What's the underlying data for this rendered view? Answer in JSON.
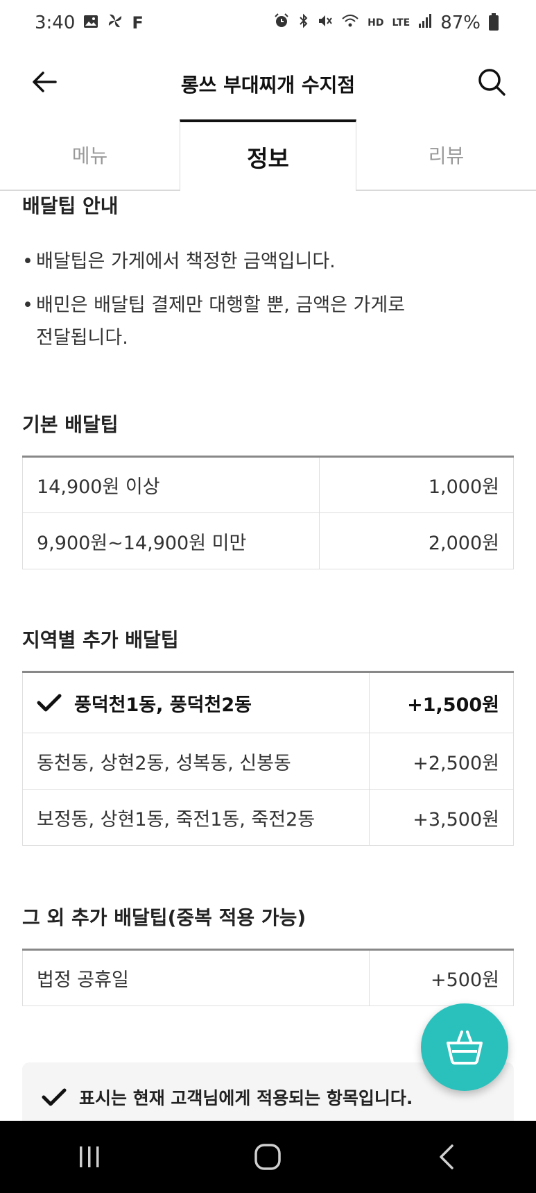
{
  "status_bar": {
    "time": "3:40",
    "left_icons": [
      "image-icon",
      "pinwheel-icon",
      "facebook-icon"
    ],
    "right_icons": [
      "alarm-icon",
      "bluetooth-icon",
      "mute-icon",
      "wifi-icon",
      "hd-voice-icon",
      "lte-icon",
      "signal-icon"
    ],
    "hd_label": "HD",
    "lte_label": "LTE",
    "battery_percent": "87%"
  },
  "header": {
    "title": "롱쓰 부대찌개 수지점"
  },
  "tabs": [
    {
      "label": "메뉴",
      "active": false
    },
    {
      "label": "정보",
      "active": true
    },
    {
      "label": "리뷰",
      "active": false
    }
  ],
  "delivery_info": {
    "title": "배달팁 안내",
    "bullets": [
      "배달팁은 가게에서 책정한 금액입니다.",
      "배민은 배달팁 결제만 대행할 뿐, 금액은 가게로 전달됩니다."
    ]
  },
  "basic_fee": {
    "title": "기본 배달팁",
    "rows": [
      {
        "condition": "14,900원 이상",
        "amount": "1,000원"
      },
      {
        "condition": "9,900원~14,900원 미만",
        "amount": "2,000원"
      }
    ]
  },
  "region_fee": {
    "title": "지역별 추가 배달팁",
    "rows": [
      {
        "area": "풍덕천1동, 풍덕천2동",
        "amount": "+1,500원",
        "selected": true
      },
      {
        "area": "동천동, 상현2동, 성복동, 신봉동",
        "amount": "+2,500원",
        "selected": false
      },
      {
        "area": "보정동, 상현1동, 죽전1동, 죽전2동",
        "amount": "+3,500원",
        "selected": false
      }
    ]
  },
  "extra_fee": {
    "title": "그 외 추가 배달팁(중복 적용 가능)",
    "rows": [
      {
        "condition": "법정 공휴일",
        "amount": "+500원"
      }
    ]
  },
  "notice": {
    "text": "표시는 현재 고객님에게 적용되는 항목입니다."
  },
  "colors": {
    "accent": "#2ac1bc",
    "text": "#222222",
    "muted": "#999999"
  }
}
